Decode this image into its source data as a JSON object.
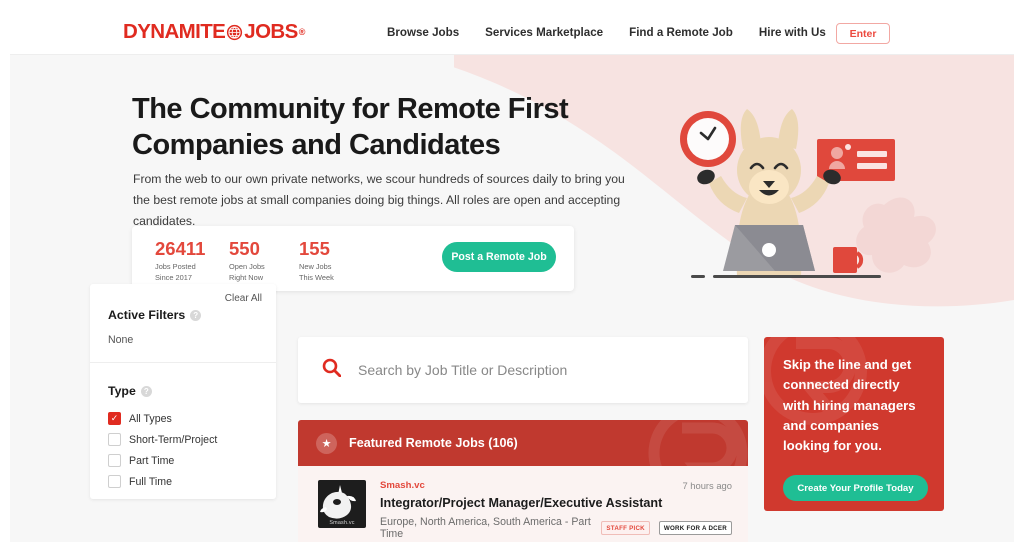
{
  "header": {
    "logo": {
      "part1": "DYNAMITE",
      "globe_icon": "globe-icon",
      "part2": "JOBS",
      "registered": "®"
    },
    "nav": [
      {
        "label": "Browse Jobs"
      },
      {
        "label": "Services Marketplace"
      },
      {
        "label": "Find a Remote Job"
      },
      {
        "label": "Hire with Us"
      }
    ],
    "enter_label": "Enter"
  },
  "hero": {
    "heading": "The Community for Remote First Companies and Candidates",
    "paragraph": "From the web to our own private networks, we scour hundreds of sources daily to bring you the best remote jobs at small companies doing big things. All roles are open and accepting candidates.",
    "stats": [
      {
        "number": "26411",
        "label_line1": "Jobs Posted",
        "label_line2": "Since 2017"
      },
      {
        "number": "550",
        "label_line1": "Open Jobs",
        "label_line2": "Right Now"
      },
      {
        "number": "155",
        "label_line1": "New Jobs",
        "label_line2": "This Week"
      }
    ],
    "post_job_label": "Post a Remote Job"
  },
  "filters": {
    "clear_all": "Clear All",
    "active_filters_title": "Active Filters",
    "help_icon": "question-mark-icon",
    "active_filters_value": "None",
    "type_title": "Type",
    "type_options": [
      {
        "label": "All Types",
        "checked": true
      },
      {
        "label": "Short-Term/Project",
        "checked": false
      },
      {
        "label": "Part Time",
        "checked": false
      },
      {
        "label": "Full Time",
        "checked": false
      }
    ]
  },
  "search": {
    "icon": "search-icon",
    "placeholder": "Search by Job Title or Description",
    "value": ""
  },
  "featured": {
    "star_icon": "star-icon",
    "header_label": "Featured Remote Jobs (106)",
    "jobs": [
      {
        "company": "Smash.vc",
        "logo_caption": "Smash.vc",
        "logo_icon": "unicorn-icon",
        "title": "Integrator/Project Manager/Executive Assistant",
        "location": "Europe, North America, South America - Part Time",
        "time": "7 hours ago",
        "badges": [
          {
            "label": "STAFF PICK",
            "style": "pick"
          },
          {
            "label": "WORK FOR A DCER",
            "style": "dcer"
          }
        ]
      }
    ]
  },
  "promo": {
    "text": "Skip the line and get connected directly with hiring managers and companies looking for you.",
    "button_label": "Create Your Profile Today"
  },
  "colors": {
    "brand_red": "#e02b20",
    "accent_green": "#1fbe94",
    "featured_header": "#c0392f",
    "promo_bg": "#d0392e",
    "page_bg": "#f7f7f7",
    "blob_pink": "#f7e3e1"
  }
}
